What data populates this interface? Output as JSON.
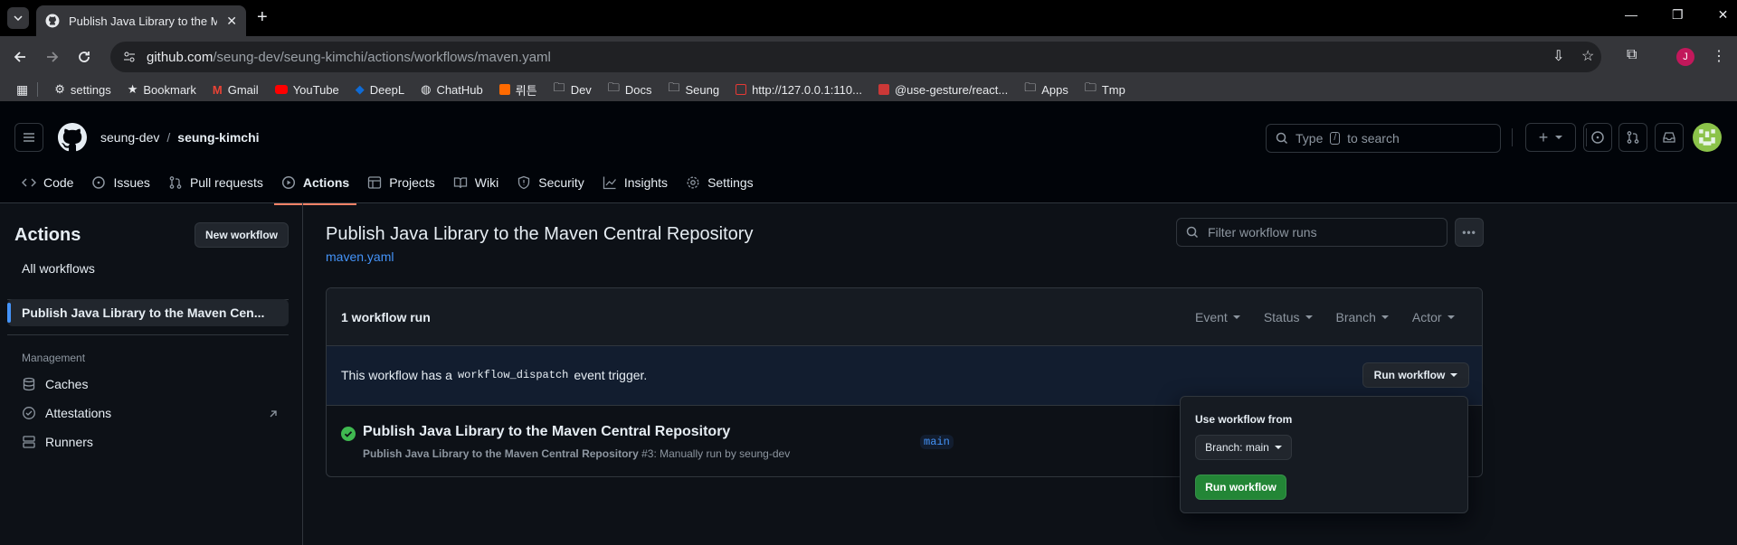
{
  "browser": {
    "tab_title": "Publish Java Library to the Maven Central Repository",
    "url_domain": "github.com",
    "url_path": "/seung-dev/seung-kimchi/actions/workflows/maven.yaml",
    "profile_initial": "J",
    "bookmarks": [
      "settings",
      "Bookmark",
      "Gmail",
      "YouTube",
      "DeepL",
      "ChatHub",
      "뤼튼",
      "Dev",
      "Docs",
      "Seung",
      "http://127.0.0.1:110...",
      "@use-gesture/react...",
      "Apps",
      "Tmp"
    ]
  },
  "header": {
    "owner": "seung-dev",
    "separator": "/",
    "repo": "seung-kimchi",
    "search_prefix": "Type",
    "search_key": "/",
    "search_suffix": "to search"
  },
  "repo_nav": [
    "Code",
    "Issues",
    "Pull requests",
    "Actions",
    "Projects",
    "Wiki",
    "Security",
    "Insights",
    "Settings"
  ],
  "sidebar": {
    "title": "Actions",
    "new_workflow": "New workflow",
    "all_workflows": "All workflows",
    "selected_workflow": "Publish Java Library to the Maven Cen...",
    "management_heading": "Management",
    "caches": "Caches",
    "attestations": "Attestations",
    "runners": "Runners"
  },
  "main": {
    "title": "Publish Java Library to the Maven Central Repository",
    "file_link": "maven.yaml",
    "filter_placeholder": "Filter workflow runs",
    "run_count": "1 workflow run",
    "filters": [
      "Event",
      "Status",
      "Branch",
      "Actor"
    ],
    "dispatch_prefix": "This workflow has a",
    "dispatch_code": "workflow_dispatch",
    "dispatch_suffix": "event trigger.",
    "run_workflow_btn": "Run workflow",
    "run": {
      "title": "Publish Java Library to the Maven Central Repository",
      "subtitle_bold": "Publish Java Library to the Maven Central Repository",
      "subtitle_rest": "#3: Manually run by seung-dev",
      "branch": "main",
      "status": "success"
    }
  },
  "popover": {
    "heading": "Use workflow from",
    "branch_select": "Branch: main",
    "submit": "Run workflow"
  },
  "colors": {
    "accent_link": "#4493f8",
    "success": "#3fb950",
    "primary_btn": "#238636",
    "active_underline": "#f78166"
  }
}
